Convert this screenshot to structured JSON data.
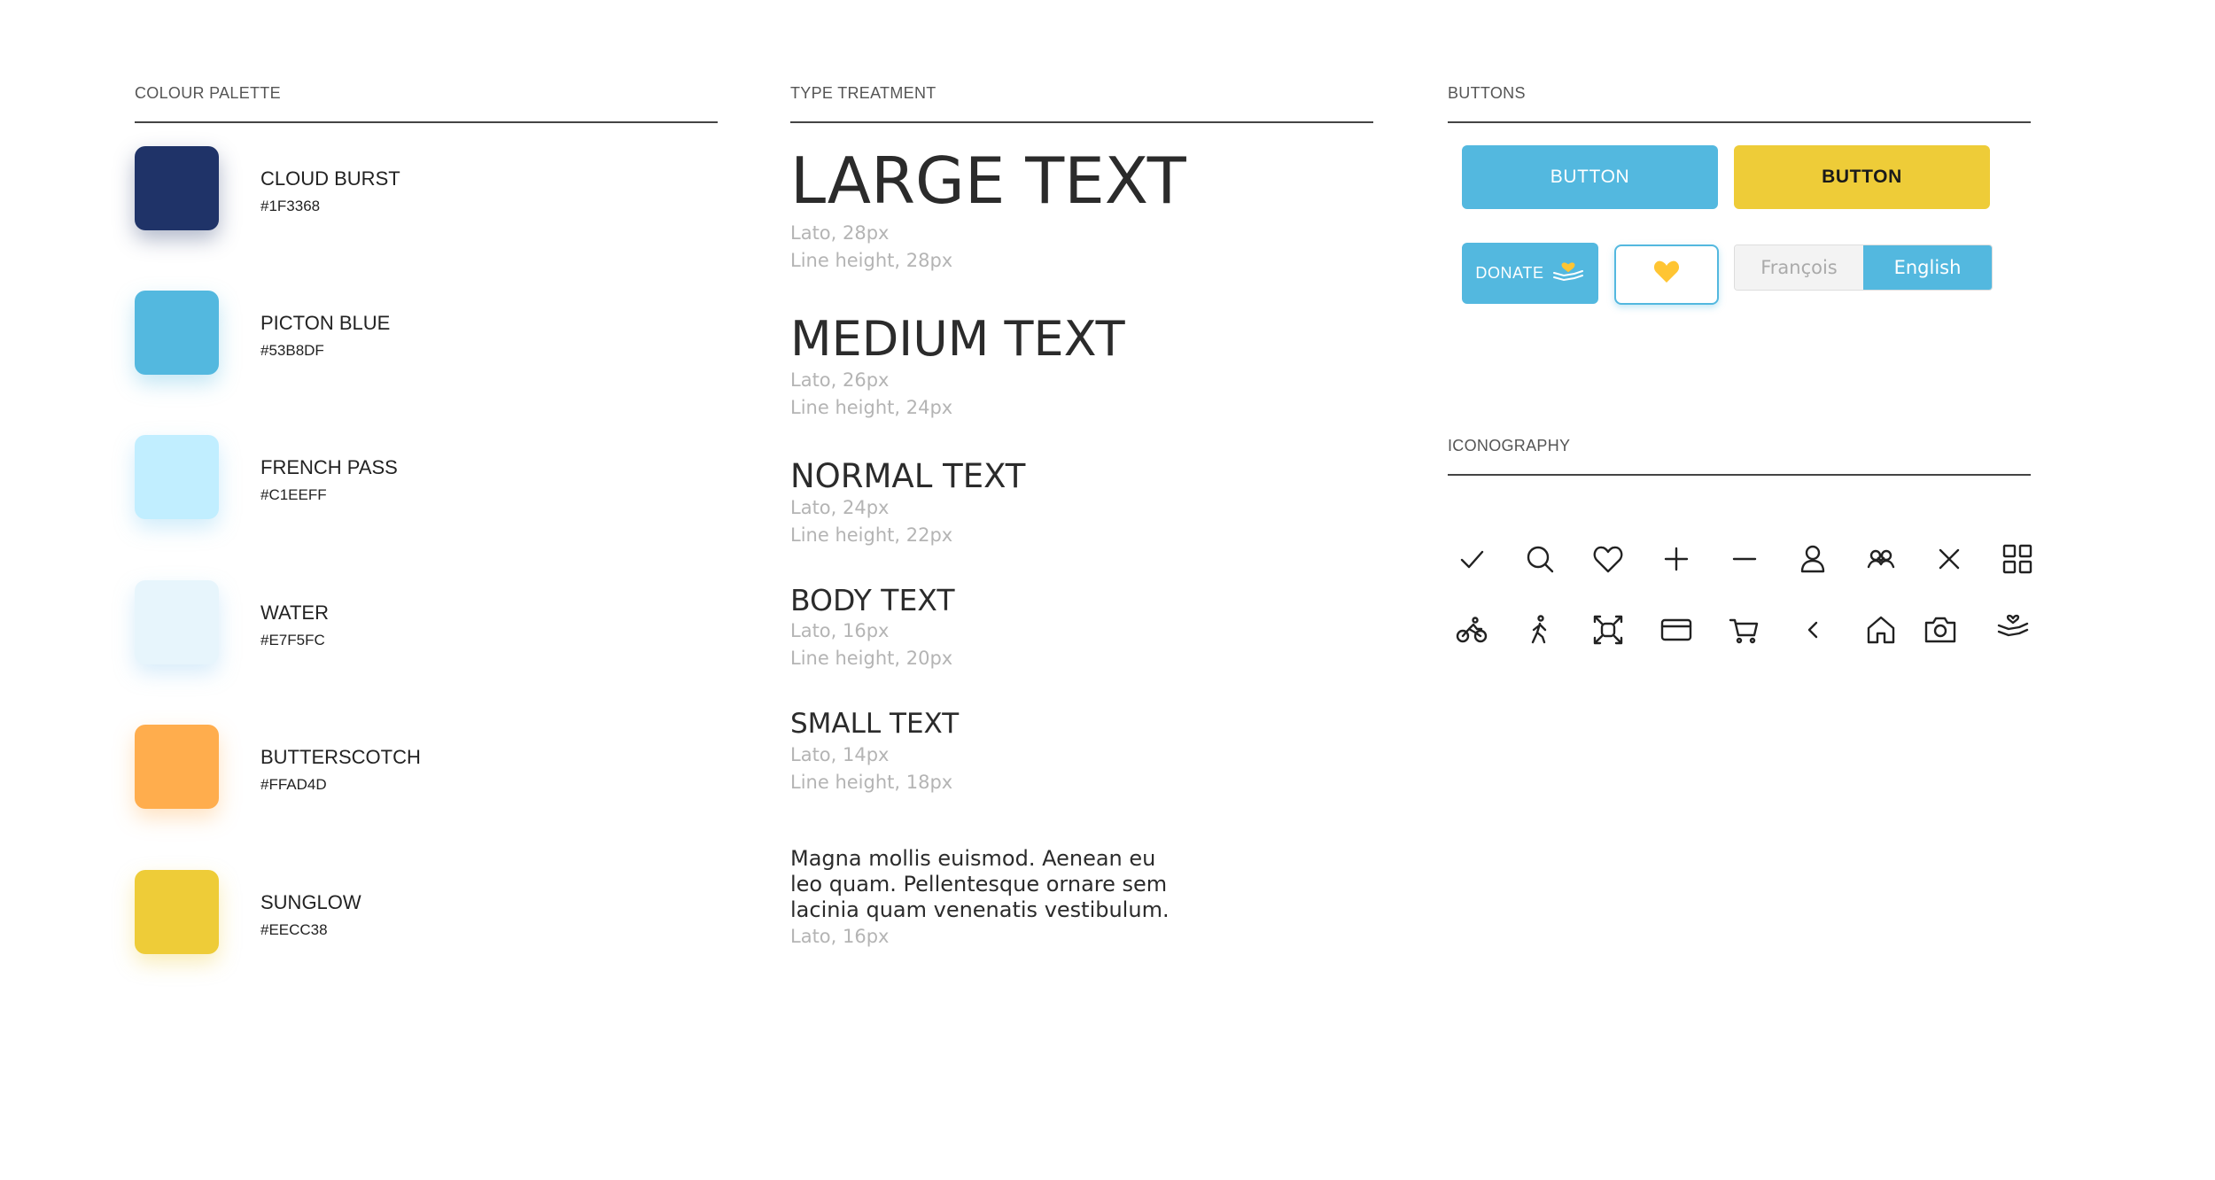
{
  "palette": {
    "title": "COLOUR PALETTE",
    "colors": [
      {
        "name": "CLOUD BURST",
        "hex": "#1F3368",
        "color": "#1F3368"
      },
      {
        "name": "PICTON BLUE",
        "hex": "#53B8DF",
        "color": "#53B8DF"
      },
      {
        "name": "FRENCH PASS",
        "hex": "#C1EEFF",
        "color": "#C1EEFF"
      },
      {
        "name": "WATER",
        "hex": "#E7F5FC",
        "color": "#E7F5FC"
      },
      {
        "name": "BUTTERSCOTCH",
        "hex": "#FFAD4D",
        "color": "#FFAD4D"
      },
      {
        "name": "SUNGLOW",
        "hex": "#EECC38",
        "color": "#EECC38"
      }
    ]
  },
  "type": {
    "title": "TYPE TREATMENT",
    "large": {
      "label": "LARGE TEXT",
      "font": "Lato, 28px",
      "line": "Line height, 28px"
    },
    "medium": {
      "label": "MEDIUM TEXT",
      "font": "Lato, 26px",
      "line": "Line height, 24px"
    },
    "normal": {
      "label": "NORMAL TEXT",
      "font": "Lato, 24px",
      "line": "Line height, 22px"
    },
    "body": {
      "label": "BODY TEXT",
      "font": "Lato, 16px",
      "line": "Line height, 20px"
    },
    "small": {
      "label": "SMALL TEXT",
      "font": "Lato, 14px",
      "line": "Line height, 18px"
    },
    "sample": {
      "text": "Magna mollis euismod. Aenean eu leo quam. Pellentesque ornare sem lacinia quam venenatis vestibulum.",
      "font": "Lato, 16px"
    }
  },
  "buttons": {
    "title": "BUTTONS",
    "primary_label": "BUTTON",
    "secondary_label": "BUTTON",
    "donate_label": "DONATE",
    "lang_fr": "François",
    "lang_en": "English",
    "accent": "#53B8DF",
    "heart_color": "#FFC533"
  },
  "iconography": {
    "title": "ICONOGRAPHY",
    "row1": [
      "check-icon",
      "search-icon",
      "heart-icon",
      "plus-icon",
      "minus-icon",
      "user-icon",
      "group-icon",
      "close-icon",
      "grid-icon"
    ],
    "row2": [
      "bike-icon",
      "walk-icon",
      "expand-icon",
      "credit-card-icon",
      "cart-icon",
      "chevron-left-icon",
      "home-icon",
      "camera-icon",
      "donate-hand-icon"
    ]
  }
}
